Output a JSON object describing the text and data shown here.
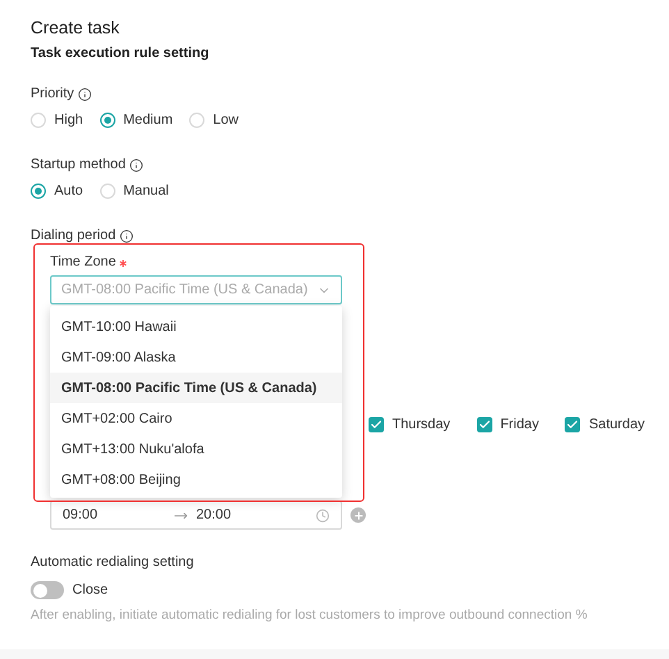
{
  "dialog": {
    "title": "Create task"
  },
  "section_title": "Task execution rule setting",
  "priority": {
    "label": "Priority",
    "options": [
      {
        "label": "High",
        "selected": false
      },
      {
        "label": "Medium",
        "selected": true
      },
      {
        "label": "Low",
        "selected": false
      }
    ]
  },
  "startup_method": {
    "label": "Startup method",
    "options": [
      {
        "label": "Auto",
        "selected": true
      },
      {
        "label": "Manual",
        "selected": false
      }
    ]
  },
  "dialing_period": {
    "label": "Dialing period",
    "time_zone": {
      "label": "Time Zone",
      "required": true,
      "value": "GMT-08:00 Pacific Time (US & Canada)",
      "expanded": true,
      "options": [
        {
          "label": "GMT-10:00 Hawaii",
          "selected": false
        },
        {
          "label": "GMT-09:00 Alaska",
          "selected": false
        },
        {
          "label": "GMT-08:00 Pacific Time (US & Canada)",
          "selected": true
        },
        {
          "label": "GMT+02:00 Cairo",
          "selected": false
        },
        {
          "label": "GMT+13:00 Nuku'alofa",
          "selected": false
        },
        {
          "label": "GMT+08:00 Beijing",
          "selected": false
        }
      ]
    },
    "weekdays": [
      {
        "label": "Thursday",
        "checked": true
      },
      {
        "label": "Friday",
        "checked": true
      },
      {
        "label": "Saturday",
        "checked": true
      }
    ],
    "time_range": {
      "start": "09:00",
      "end": "20:00"
    }
  },
  "auto_redial": {
    "label": "Automatic redialing setting",
    "on": false,
    "state_text": "Close",
    "hint": "After enabling, initiate automatic redialing for lost customers to improve outbound connection %"
  }
}
